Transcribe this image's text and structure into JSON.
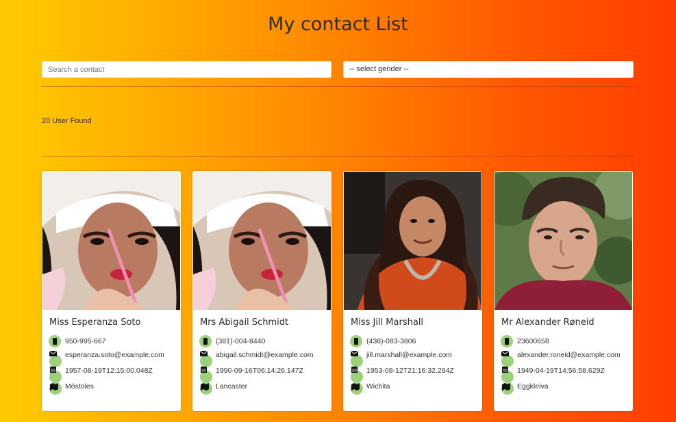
{
  "page": {
    "title": "My contact List"
  },
  "filters": {
    "search_placeholder": "Search a contact",
    "gender_select_value": "-- select gender --"
  },
  "results": {
    "count_text": "20 User Found"
  },
  "colors": {
    "gradient_start": "#ffcc00",
    "gradient_end": "#ff3d00",
    "icon_circle": "#9cd07a"
  },
  "contacts": [
    {
      "name": "Miss Esperanza Soto",
      "phone": "950-995-667",
      "email": "esperanza.soto@example.com",
      "dob": "1957-08-19T12:15:00.048Z",
      "city": "Móstoles",
      "photo_icon": "woman-with-straw-photo"
    },
    {
      "name": "Mrs Abigail Schmidt",
      "phone": "(381)-004-8440",
      "email": "abigail.schmidt@example.com",
      "dob": "1990-09-16T06:14:26.147Z",
      "city": "Lancaster",
      "photo_icon": "woman-with-straw-photo"
    },
    {
      "name": "Miss Jill Marshall",
      "phone": "(438)-083-3806",
      "email": "jill.marshall@example.com",
      "dob": "1953-08-12T21:16:32.294Z",
      "city": "Wichita",
      "photo_icon": "woman-orange-top-photo"
    },
    {
      "name": "Mr Alexander Røneid",
      "phone": "23600658",
      "email": "alexander.roneid@example.com",
      "dob": "1949-04-19T14:56:58.629Z",
      "city": "Eggkleiva",
      "photo_icon": "man-portrait-photo"
    }
  ],
  "icons": {
    "phone": "phone-icon",
    "email": "envelope-icon",
    "dob": "calendar-icon",
    "city": "map-icon"
  }
}
